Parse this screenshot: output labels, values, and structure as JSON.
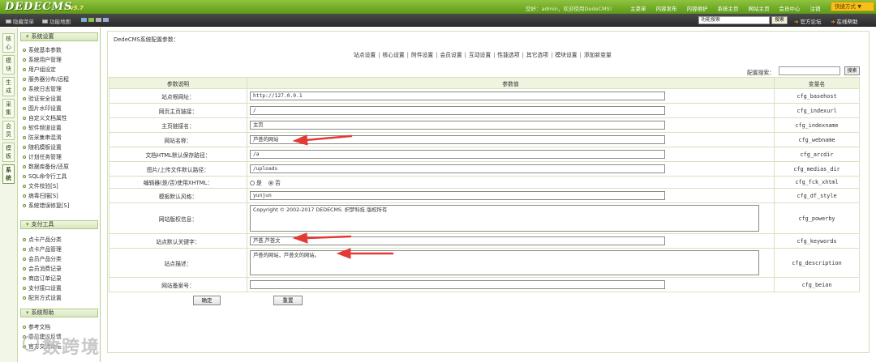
{
  "app": {
    "logo": "DEDECMS",
    "version": "v5.7"
  },
  "topbar": {
    "welcome": "您好：admin，欢迎使用DedeCMS!",
    "nav": [
      "主菜单",
      "内容发布",
      "内容维护",
      "系统主页",
      "网站主页",
      "会员中心",
      "注销"
    ],
    "quick": "快捷方式 ▼"
  },
  "bar2": {
    "hide_menu": "隐藏菜单",
    "func_map": "功能地图",
    "search_value": "功能搜索",
    "search_btn": "搜索",
    "forum": "官方论坛",
    "help": "在线帮助"
  },
  "vtabs": [
    "核心",
    "模块",
    "生成",
    "采集",
    "会员",
    "模板",
    "系统"
  ],
  "sidebar": {
    "group1": "系统设置",
    "items1": [
      "系统基本参数",
      "系统用户管理",
      "用户组设定",
      "服务器分布/远程",
      "系统日志管理",
      "验证安全设置",
      "图片水印设置",
      "自定义文档属性",
      "软件频道设置",
      "防采集串混淆",
      "随机模板设置",
      "计划任务管理",
      "数据库备份/还原",
      "SQL命令行工具",
      "文件校验[S]",
      "病毒扫描[S]",
      "系统错误修复[S]"
    ],
    "group2": "支付工具",
    "items2": [
      "点卡产品分类",
      "点卡产品管理",
      "会员产品分类",
      "会员消费记录",
      "商店订单记录",
      "支付接口设置",
      "配货方式设置"
    ],
    "group3": "系统帮助",
    "items3": [
      "参考文档",
      "意见建议反馈",
      "官方交流论坛"
    ]
  },
  "main": {
    "title": "DedeCMS系统配置参数：",
    "tabs": [
      "站点设置",
      "核心设置",
      "附件设置",
      "会员设置",
      "互动设置",
      "性能选项",
      "其它选项",
      "模块设置",
      "添加新变量"
    ],
    "cfg_search_label": "配置搜索：",
    "cfg_search_btn": "搜索",
    "headers": {
      "name": "参数说明",
      "value": "参数值",
      "var": "变量名"
    },
    "rows": [
      {
        "label": "站点根网址：",
        "value": "http://127.0.0.1",
        "var": "cfg_basehost"
      },
      {
        "label": "网页主页链接：",
        "value": "/",
        "var": "cfg_indexurl"
      },
      {
        "label": "主页链接名：",
        "value": "主页",
        "var": "cfg_indexname"
      },
      {
        "label": "网站名称：",
        "value": "芦荟的网站",
        "var": "cfg_webname"
      },
      {
        "label": "文档HTML默认保存路径：",
        "value": "/a",
        "var": "cfg_arcdir"
      },
      {
        "label": "图片/上传文件默认路径：",
        "value": "/uploads",
        "var": "cfg_medias_dir"
      },
      {
        "label": "编辑器(是/否)使用XHTML：",
        "opt_yes": "是",
        "opt_no": "否",
        "var": "cfg_fck_xhtml"
      },
      {
        "label": "模板默认风格：",
        "value": "yunjun",
        "var": "cfg_df_style"
      },
      {
        "label": "网站版权信息：",
        "value": "Copyright &copy; 2002-2017 DEDECMS. 织梦科技 版权所有",
        "var": "cfg_powerby"
      },
      {
        "label": "站点默认关键字：",
        "value": "芦荟,芦荟文",
        "var": "cfg_keywords"
      },
      {
        "label": "站点描述：",
        "value": "芦荟的网站，芦荟文的网站。",
        "var": "cfg_description"
      },
      {
        "label": "网站备案号：",
        "value": "",
        "var": "cfg_beian"
      }
    ],
    "confirm_btn": "确定",
    "reset_btn": "重置"
  },
  "watermark": "数跨境"
}
